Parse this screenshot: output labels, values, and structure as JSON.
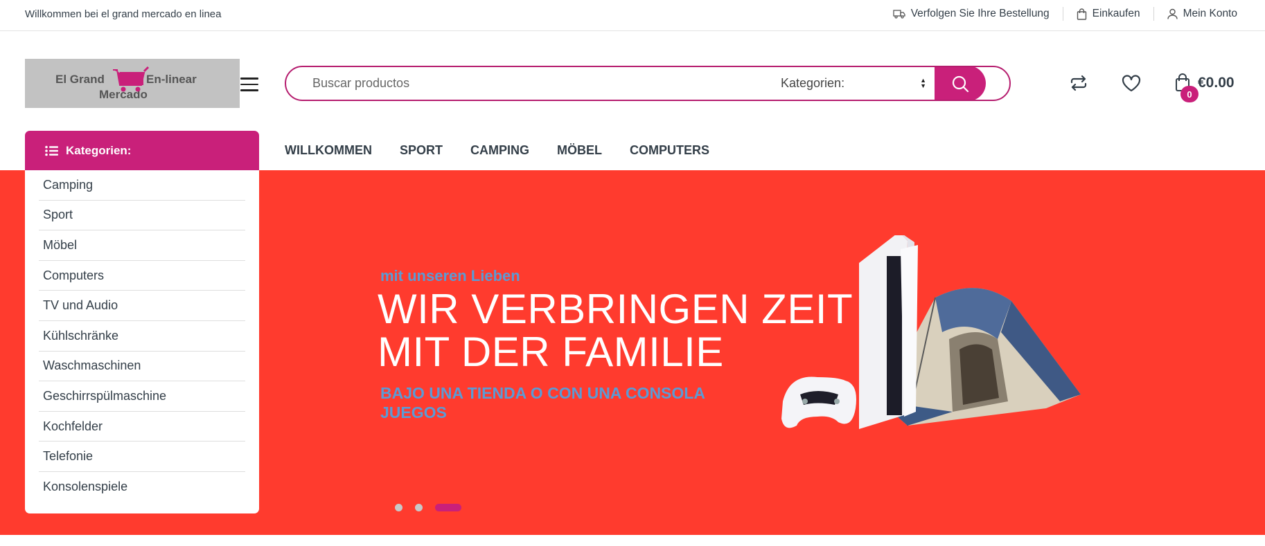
{
  "topbar": {
    "welcome": "Willkommen bei el grand mercado en linea",
    "track_order": "Verfolgen Sie Ihre Bestellung",
    "shop": "Einkaufen",
    "account": "Mein Konto"
  },
  "logo": {
    "line1_left": "El Grand",
    "line1_right": "En-linear",
    "line2": "Mercado"
  },
  "search": {
    "placeholder": "Buscar productos",
    "category_label": "Kategorien:"
  },
  "cart": {
    "count": "0",
    "total": "€0.00"
  },
  "categories": {
    "title": "Kategorien:",
    "items": [
      "Camping",
      "Sport",
      "Möbel",
      "Computers",
      "TV und Audio",
      "Kühlschränke",
      "Waschmaschinen",
      "Geschirrspülmaschine",
      "Kochfelder",
      "Telefonie",
      "Konsolenspiele"
    ]
  },
  "nav": [
    "WILLKOMMEN",
    "SPORT",
    "CAMPING",
    "MÖBEL",
    "COMPUTERS"
  ],
  "hero": {
    "pre_title": "mit unseren Lieben",
    "title_line1": "WIR VERBRINGEN ZEIT",
    "title_line2": "MIT DER FAMILIE",
    "subtitle": "BAJO UNA TIENDA O CON UNA CONSOLA JUEGOS",
    "slide_count": 3,
    "active_slide": 3
  },
  "colors": {
    "accent": "#c9207a",
    "hero_bg": "#ff3b2e",
    "hero_text_blue": "#5b9bd5"
  },
  "icons": [
    "truck-icon",
    "shopping-bag-icon",
    "user-icon",
    "menu-icon",
    "search-icon",
    "compare-icon",
    "heart-icon",
    "cart-icon",
    "list-icon"
  ]
}
